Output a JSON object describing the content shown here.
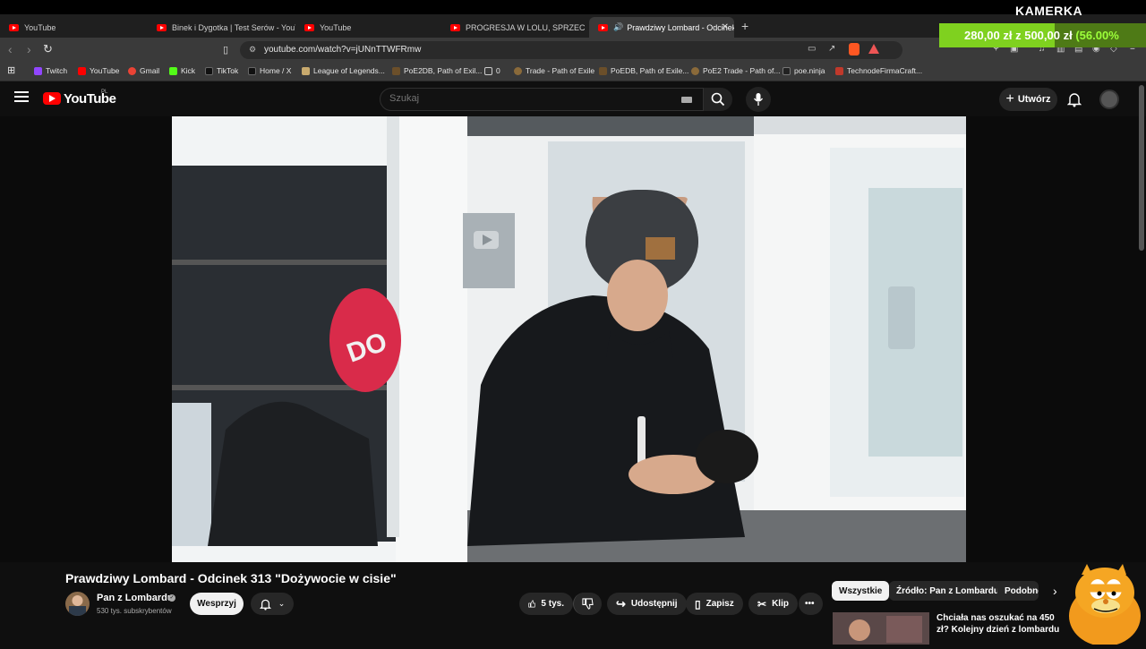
{
  "browser": {
    "tabs": [
      {
        "label": "YouTube",
        "active": false
      },
      {
        "label": "Binek i Dygotka | Test Serów - YouTub",
        "active": false
      },
      {
        "label": "YouTube",
        "active": false
      },
      {
        "label": "PROGRESJA W LOLU, SPRZECZKI Z R",
        "active": false
      },
      {
        "label": "Prawdziwy Lombard - Odcinek",
        "active": true
      }
    ],
    "url": "youtube.com/watch?v=jUNnTTWFRmw",
    "bookmarks": [
      {
        "label": "Twitch",
        "color": "#9146ff"
      },
      {
        "label": "YouTube",
        "color": "#ff0000"
      },
      {
        "label": "Gmail",
        "color": "#ea4335"
      },
      {
        "label": "Kick",
        "color": "#53fc18"
      },
      {
        "label": "TikTok",
        "color": "#111111"
      },
      {
        "label": "Home / X",
        "color": "#111111"
      },
      {
        "label": "League of Legends...",
        "color": "#c8aa6e"
      },
      {
        "label": "PoE2DB, Path of Exil...",
        "color": "#6b4f2a"
      },
      {
        "label": "0",
        "color": "#3a3a3a"
      },
      {
        "label": "Trade - Path of Exile",
        "color": "#8a6a3a"
      },
      {
        "label": "PoEDB, Path of Exile...",
        "color": "#6b4f2a"
      },
      {
        "label": "PoE2 Trade - Path of...",
        "color": "#8a6a3a"
      },
      {
        "label": "poe.ninja",
        "color": "#222222"
      },
      {
        "label": "TechnodeFirmaCraft...",
        "color": "#c0392b"
      }
    ]
  },
  "overlay": {
    "kamerka": "KAMERKA",
    "goal_text": "280,00 zł z 500,00 zł",
    "goal_pct": "(56.00%",
    "goal_progress": 0.56
  },
  "youtube": {
    "logo": "YouTube",
    "region": "PL",
    "search_placeholder": "Szukaj",
    "create_label": "Utwórz"
  },
  "video": {
    "title": "Prawdziwy Lombard - Odcinek 313 \"Dożywocie w cisie\"",
    "channel": "Pan z Lombardu",
    "subscribers": "530 tys. subskrybentów",
    "support_label": "Wesprzyj",
    "like_count": "5 tys.",
    "share_label": "Udostępnij",
    "save_label": "Zapisz",
    "clip_label": "Klip"
  },
  "chips": [
    "Wszystkie",
    "Źródło: Pan z Lombardu",
    "Podobne"
  ],
  "recommendation": {
    "title": "Chciała nas oszukać na 450 zł? Kolejny dzień z lombardu"
  },
  "colors": {
    "accent": "#ff0000",
    "background": "#0f0f0f",
    "goal_green": "#7fd11f"
  }
}
